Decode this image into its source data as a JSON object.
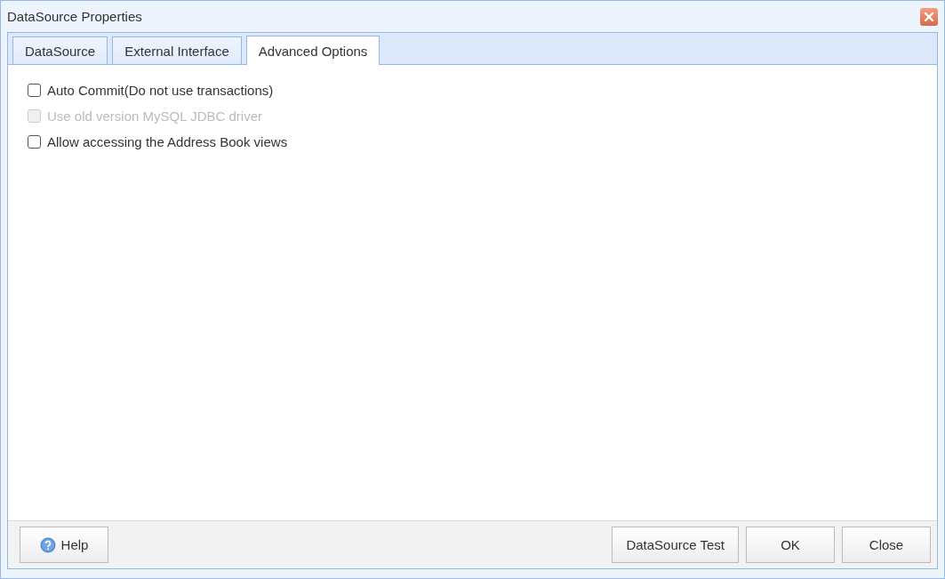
{
  "window": {
    "title": "DataSource Properties"
  },
  "tabs": [
    {
      "label": "DataSource",
      "selected": false
    },
    {
      "label": "External Interface",
      "selected": false
    },
    {
      "label": "Advanced Options",
      "selected": true
    }
  ],
  "options": [
    {
      "label": "Auto Commit(Do not use transactions)",
      "checked": false,
      "disabled": false
    },
    {
      "label": "Use old version MySQL JDBC driver",
      "checked": false,
      "disabled": true
    },
    {
      "label": "Allow accessing the Address Book views",
      "checked": false,
      "disabled": false
    }
  ],
  "footer": {
    "help_button": "Help",
    "buttons": [
      "DataSource Test",
      "OK",
      "Close"
    ]
  }
}
